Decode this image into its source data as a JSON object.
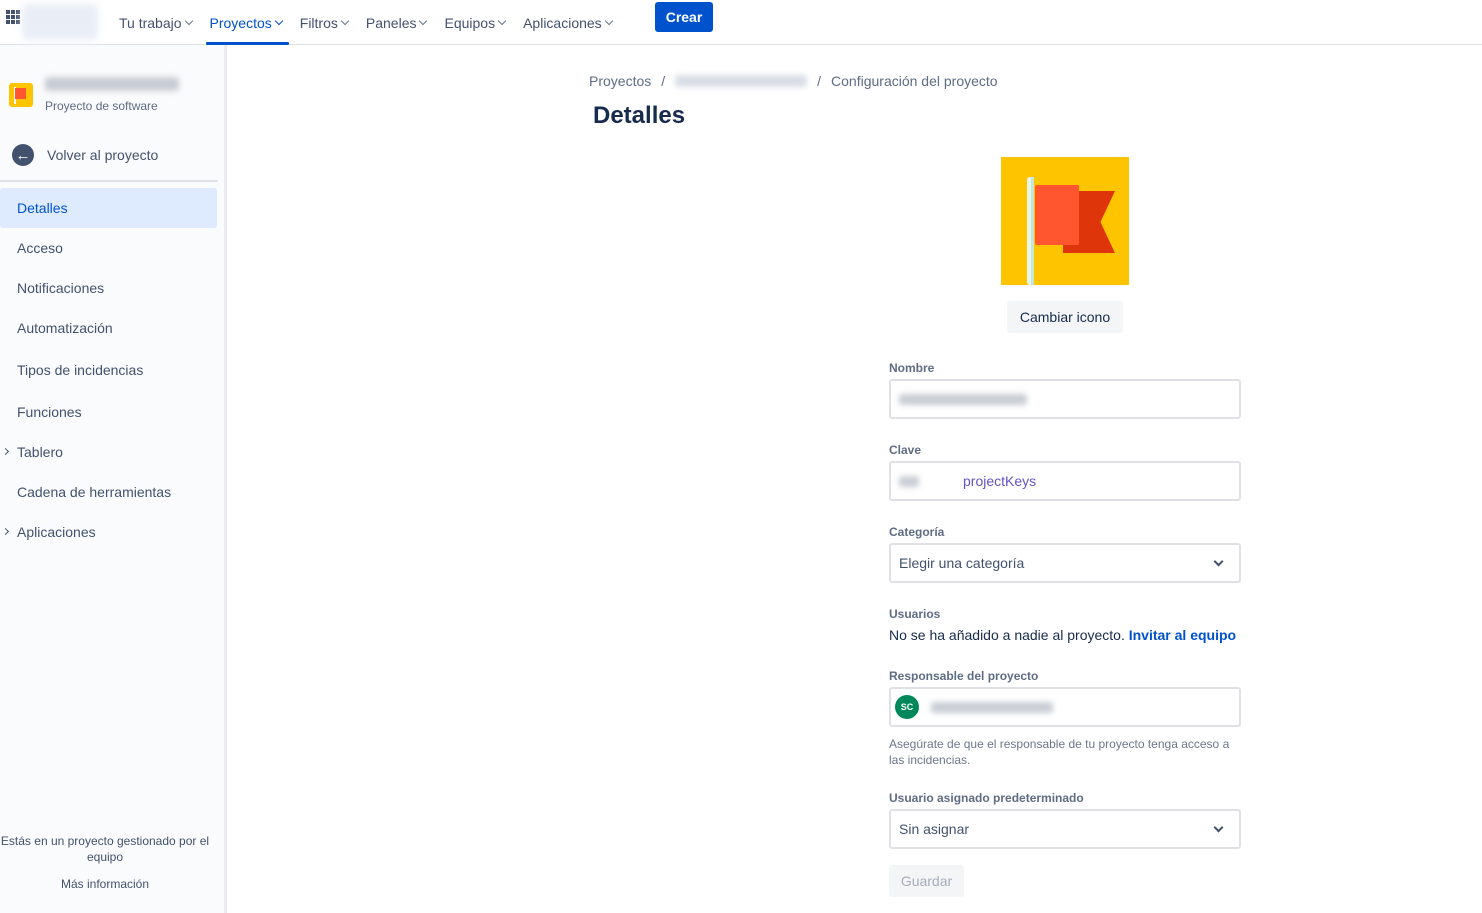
{
  "topbar": {
    "nav": [
      {
        "label": "Tu trabajo",
        "active": false
      },
      {
        "label": "Proyectos",
        "active": true
      },
      {
        "label": "Filtros",
        "active": false
      },
      {
        "label": "Paneles",
        "active": false
      },
      {
        "label": "Equipos",
        "active": false
      },
      {
        "label": "Aplicaciones",
        "active": false
      }
    ],
    "create_label": "Crear",
    "accent": "#0052cc"
  },
  "sidebar": {
    "project_type": "Proyecto de software",
    "back_label": "Volver al proyecto",
    "items": [
      {
        "label": "Detalles",
        "selected": true
      },
      {
        "label": "Acceso"
      },
      {
        "label": "Notificaciones"
      },
      {
        "label": "Automatización"
      },
      {
        "label": "Tipos de incidencias"
      },
      {
        "label": "Funciones"
      },
      {
        "label": "Tablero",
        "expandable": true
      },
      {
        "label": "Cadena de herramientas"
      },
      {
        "label": "Aplicaciones",
        "expandable": true
      }
    ],
    "footer_note": "Estás en un proyecto gestionado por el equipo",
    "more_info": "Más información"
  },
  "breadcrumb": {
    "root": "Proyectos",
    "sep": "/",
    "current": "Configuración del proyecto"
  },
  "page": {
    "title": "Detalles",
    "change_icon_label": "Cambiar icono"
  },
  "form": {
    "name_label": "Nombre",
    "key_label": "Clave",
    "key_tag": "projectKeys",
    "category_label": "Categoría",
    "category_value": "Elegir una categoría",
    "users_label": "Usuarios",
    "users_text": "No se ha añadido a nadie al proyecto.",
    "invite_label": "Invitar al equipo",
    "lead_label": "Responsable del proyecto",
    "lead_initials": "SC",
    "lead_helper": "Asegúrate de que el responsable de tu proyecto tenga acceso a las incidencias.",
    "assignee_label": "Usuario asignado predeterminado",
    "assignee_value": "Sin asignar",
    "save_label": "Guardar"
  }
}
